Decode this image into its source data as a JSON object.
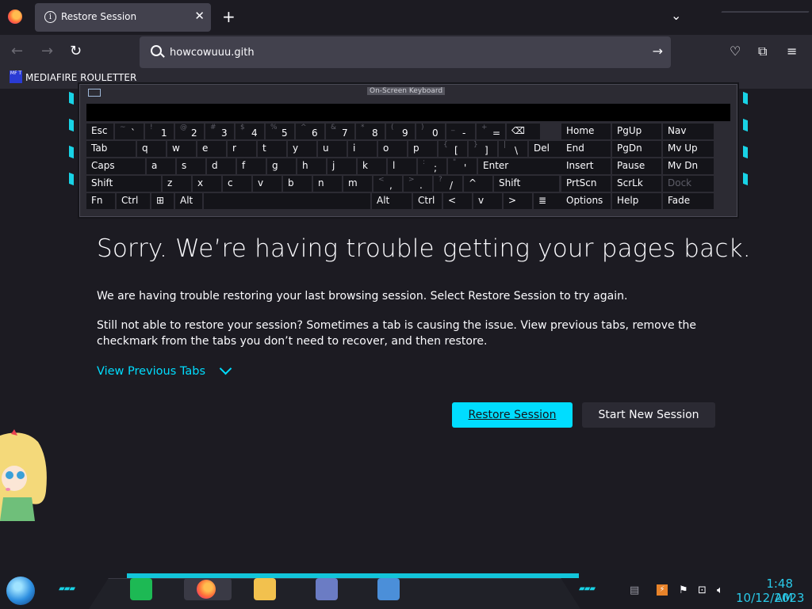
{
  "tab": {
    "title": "Restore Session"
  },
  "urlbar": {
    "value": "howcowuuu.gith"
  },
  "bookmarks": [
    {
      "label": "MEDIAFIRE ROULETTER",
      "icon_text": "MF T"
    }
  ],
  "osk": {
    "title": "On-Screen Keyboard",
    "rows": [
      [
        {
          "l": "Esc"
        },
        {
          "s": "~",
          "m": "`"
        },
        {
          "s": "!",
          "m": "1"
        },
        {
          "s": "@",
          "m": "2"
        },
        {
          "s": "#",
          "m": "3"
        },
        {
          "s": "$",
          "m": "4"
        },
        {
          "s": "%",
          "m": "5"
        },
        {
          "s": "^",
          "m": "6"
        },
        {
          "s": "&",
          "m": "7"
        },
        {
          "s": "*",
          "m": "8"
        },
        {
          "s": "(",
          "m": "9"
        },
        {
          "s": ")",
          "m": "0"
        },
        {
          "s": "_",
          "m": "-"
        },
        {
          "s": "+",
          "m": "="
        },
        {
          "l": "⌫"
        },
        {
          "l": "Home"
        },
        {
          "l": "PgUp"
        },
        {
          "l": "Nav"
        }
      ],
      [
        {
          "l": "Tab"
        },
        {
          "l": "q"
        },
        {
          "l": "w"
        },
        {
          "l": "e"
        },
        {
          "l": "r"
        },
        {
          "l": "t"
        },
        {
          "l": "y"
        },
        {
          "l": "u"
        },
        {
          "l": "i"
        },
        {
          "l": "o"
        },
        {
          "l": "p"
        },
        {
          "s": "{",
          "m": "["
        },
        {
          "s": "}",
          "m": "]"
        },
        {
          "s": "|",
          "m": "\\"
        },
        {
          "l": "Del"
        },
        {
          "l": "End"
        },
        {
          "l": "PgDn"
        },
        {
          "l": "Mv Up"
        }
      ],
      [
        {
          "l": "Caps"
        },
        {
          "l": "a"
        },
        {
          "l": "s"
        },
        {
          "l": "d"
        },
        {
          "l": "f"
        },
        {
          "l": "g"
        },
        {
          "l": "h"
        },
        {
          "l": "j"
        },
        {
          "l": "k"
        },
        {
          "l": "l"
        },
        {
          "s": ":",
          "m": ";"
        },
        {
          "s": "\"",
          "m": "'"
        },
        {
          "l": "Enter"
        },
        {
          "l": "Insert"
        },
        {
          "l": "Pause"
        },
        {
          "l": "Mv Dn"
        }
      ],
      [
        {
          "l": "Shift"
        },
        {
          "l": "z"
        },
        {
          "l": "x"
        },
        {
          "l": "c"
        },
        {
          "l": "v"
        },
        {
          "l": "b"
        },
        {
          "l": "n"
        },
        {
          "l": "m"
        },
        {
          "s": "<",
          "m": ","
        },
        {
          "s": ">",
          "m": "."
        },
        {
          "s": "?",
          "m": "/"
        },
        {
          "l": "^"
        },
        {
          "l": "Shift"
        },
        {
          "l": "PrtScn"
        },
        {
          "l": "ScrLk"
        },
        {
          "l": "Dock"
        }
      ],
      [
        {
          "l": "Fn"
        },
        {
          "l": "Ctrl"
        },
        {
          "l": "⊞"
        },
        {
          "l": "Alt"
        },
        {
          "l": ""
        },
        {
          "l": "Alt"
        },
        {
          "l": "Ctrl"
        },
        {
          "l": "<"
        },
        {
          "l": "v"
        },
        {
          "l": ">"
        },
        {
          "l": "≣"
        },
        {
          "l": "Options"
        },
        {
          "l": "Help"
        },
        {
          "l": "Fade"
        }
      ]
    ]
  },
  "page": {
    "title": "Sorry. We’re having trouble getting your pages back.",
    "para1": "We are having trouble restoring your last browsing session. Select Restore Session to try again.",
    "para2": "Still not able to restore your session? Sometimes a tab is causing the issue. View previous tabs, remove the checkmark from the tabs you don’t need to recover, and then restore.",
    "view_tabs": "View Previous Tabs",
    "restore_btn": "Restore Session",
    "new_btn": "Start New Session"
  },
  "clock": {
    "time": "1:48 AM",
    "date": "10/12/2023"
  },
  "colors": {
    "accent": "#00ddff",
    "bg": "#1c1b22",
    "taskbar_cyan": "#12c5da"
  }
}
